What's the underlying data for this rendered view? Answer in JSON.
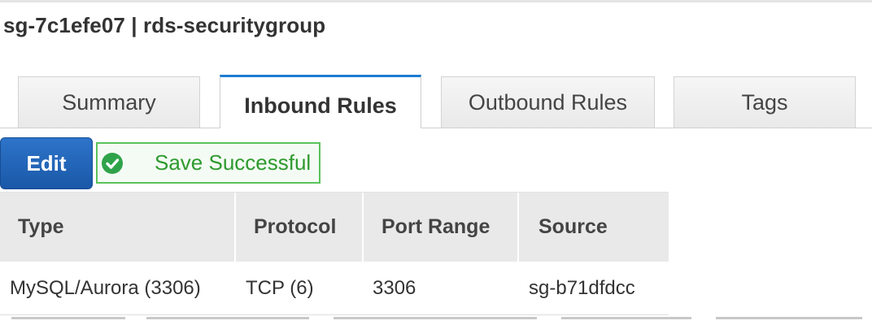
{
  "header": {
    "title": "sg-7c1efe07 | rds-securitygroup"
  },
  "tabs": [
    {
      "label": "Summary",
      "active": false
    },
    {
      "label": "Inbound Rules",
      "active": true
    },
    {
      "label": "Outbound Rules",
      "active": false
    },
    {
      "label": "Tags",
      "active": false
    }
  ],
  "actions": {
    "edit_label": "Edit",
    "status_message": "Save Successful",
    "status_icon": "check-circle-icon"
  },
  "table": {
    "columns": [
      "Type",
      "Protocol",
      "Port Range",
      "Source"
    ],
    "rows": [
      [
        "MySQL/Aurora (3306)",
        "TCP (6)",
        "3306",
        "sg-b71dfdcc"
      ]
    ]
  },
  "colors": {
    "accent": "#1b7bd1",
    "button": "#1f5fb3",
    "success": "#2e9a2e",
    "header_bg": "#e9e9e9"
  }
}
